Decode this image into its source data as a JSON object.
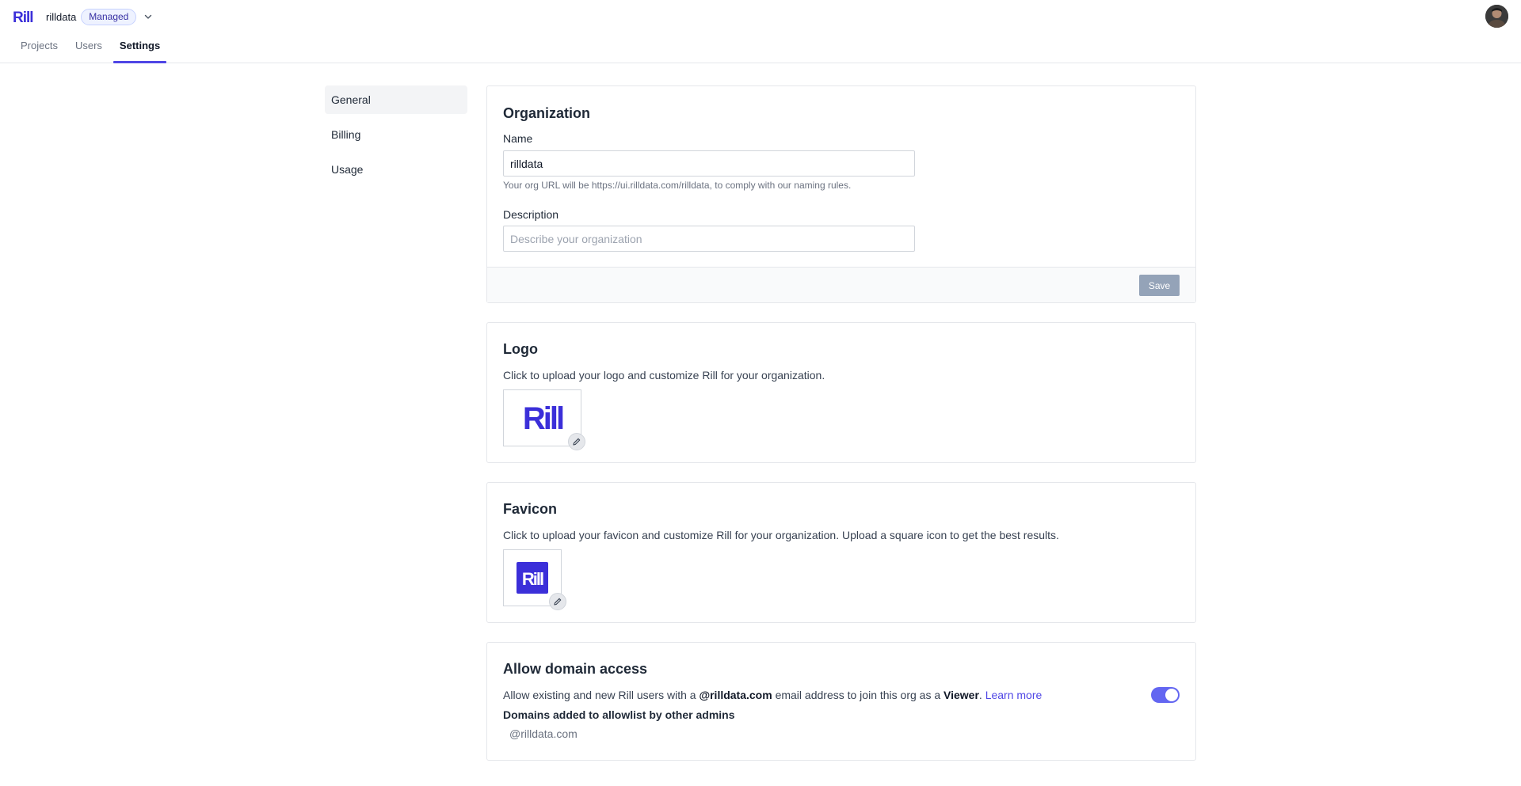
{
  "header": {
    "org_name": "rilldata",
    "org_badge": "Managed",
    "brand_logo_text": "Rill",
    "avatar_icon": "user-avatar"
  },
  "tabs": [
    {
      "label": "Projects",
      "active": false
    },
    {
      "label": "Users",
      "active": false
    },
    {
      "label": "Settings",
      "active": true
    }
  ],
  "sidebar": {
    "items": [
      {
        "label": "General",
        "active": true
      },
      {
        "label": "Billing",
        "active": false
      },
      {
        "label": "Usage",
        "active": false
      }
    ]
  },
  "organization": {
    "title": "Organization",
    "name_label": "Name",
    "name_value": "rilldata",
    "name_hint": "Your org URL will be https://ui.rilldata.com/rilldata, to comply with our naming rules.",
    "description_label": "Description",
    "description_placeholder": "Describe your organization",
    "description_value": "",
    "save_label": "Save"
  },
  "logo": {
    "title": "Logo",
    "description": "Click to upload your logo and customize Rill for your organization.",
    "image_text": "Rill"
  },
  "favicon": {
    "title": "Favicon",
    "description": "Click to upload your favicon and customize Rill for your organization. Upload a square icon to get the best results.",
    "image_text": "Rill"
  },
  "domain_access": {
    "title": "Allow domain access",
    "text_prefix": "Allow existing and new Rill users with a ",
    "domain_bold": "@rilldata.com",
    "text_middle": " email address to join this org as a ",
    "role_bold": "Viewer",
    "text_suffix": ". ",
    "learn_more": "Learn more",
    "enabled": true,
    "allowlist_heading": "Domains added to allowlist by other admins",
    "allowlist": [
      "@rilldata.com"
    ]
  },
  "colors": {
    "brand": "#3b2fd9",
    "accent": "#4f46e5",
    "toggle_on": "#6366f1",
    "save_disabled": "#94a3b8"
  }
}
